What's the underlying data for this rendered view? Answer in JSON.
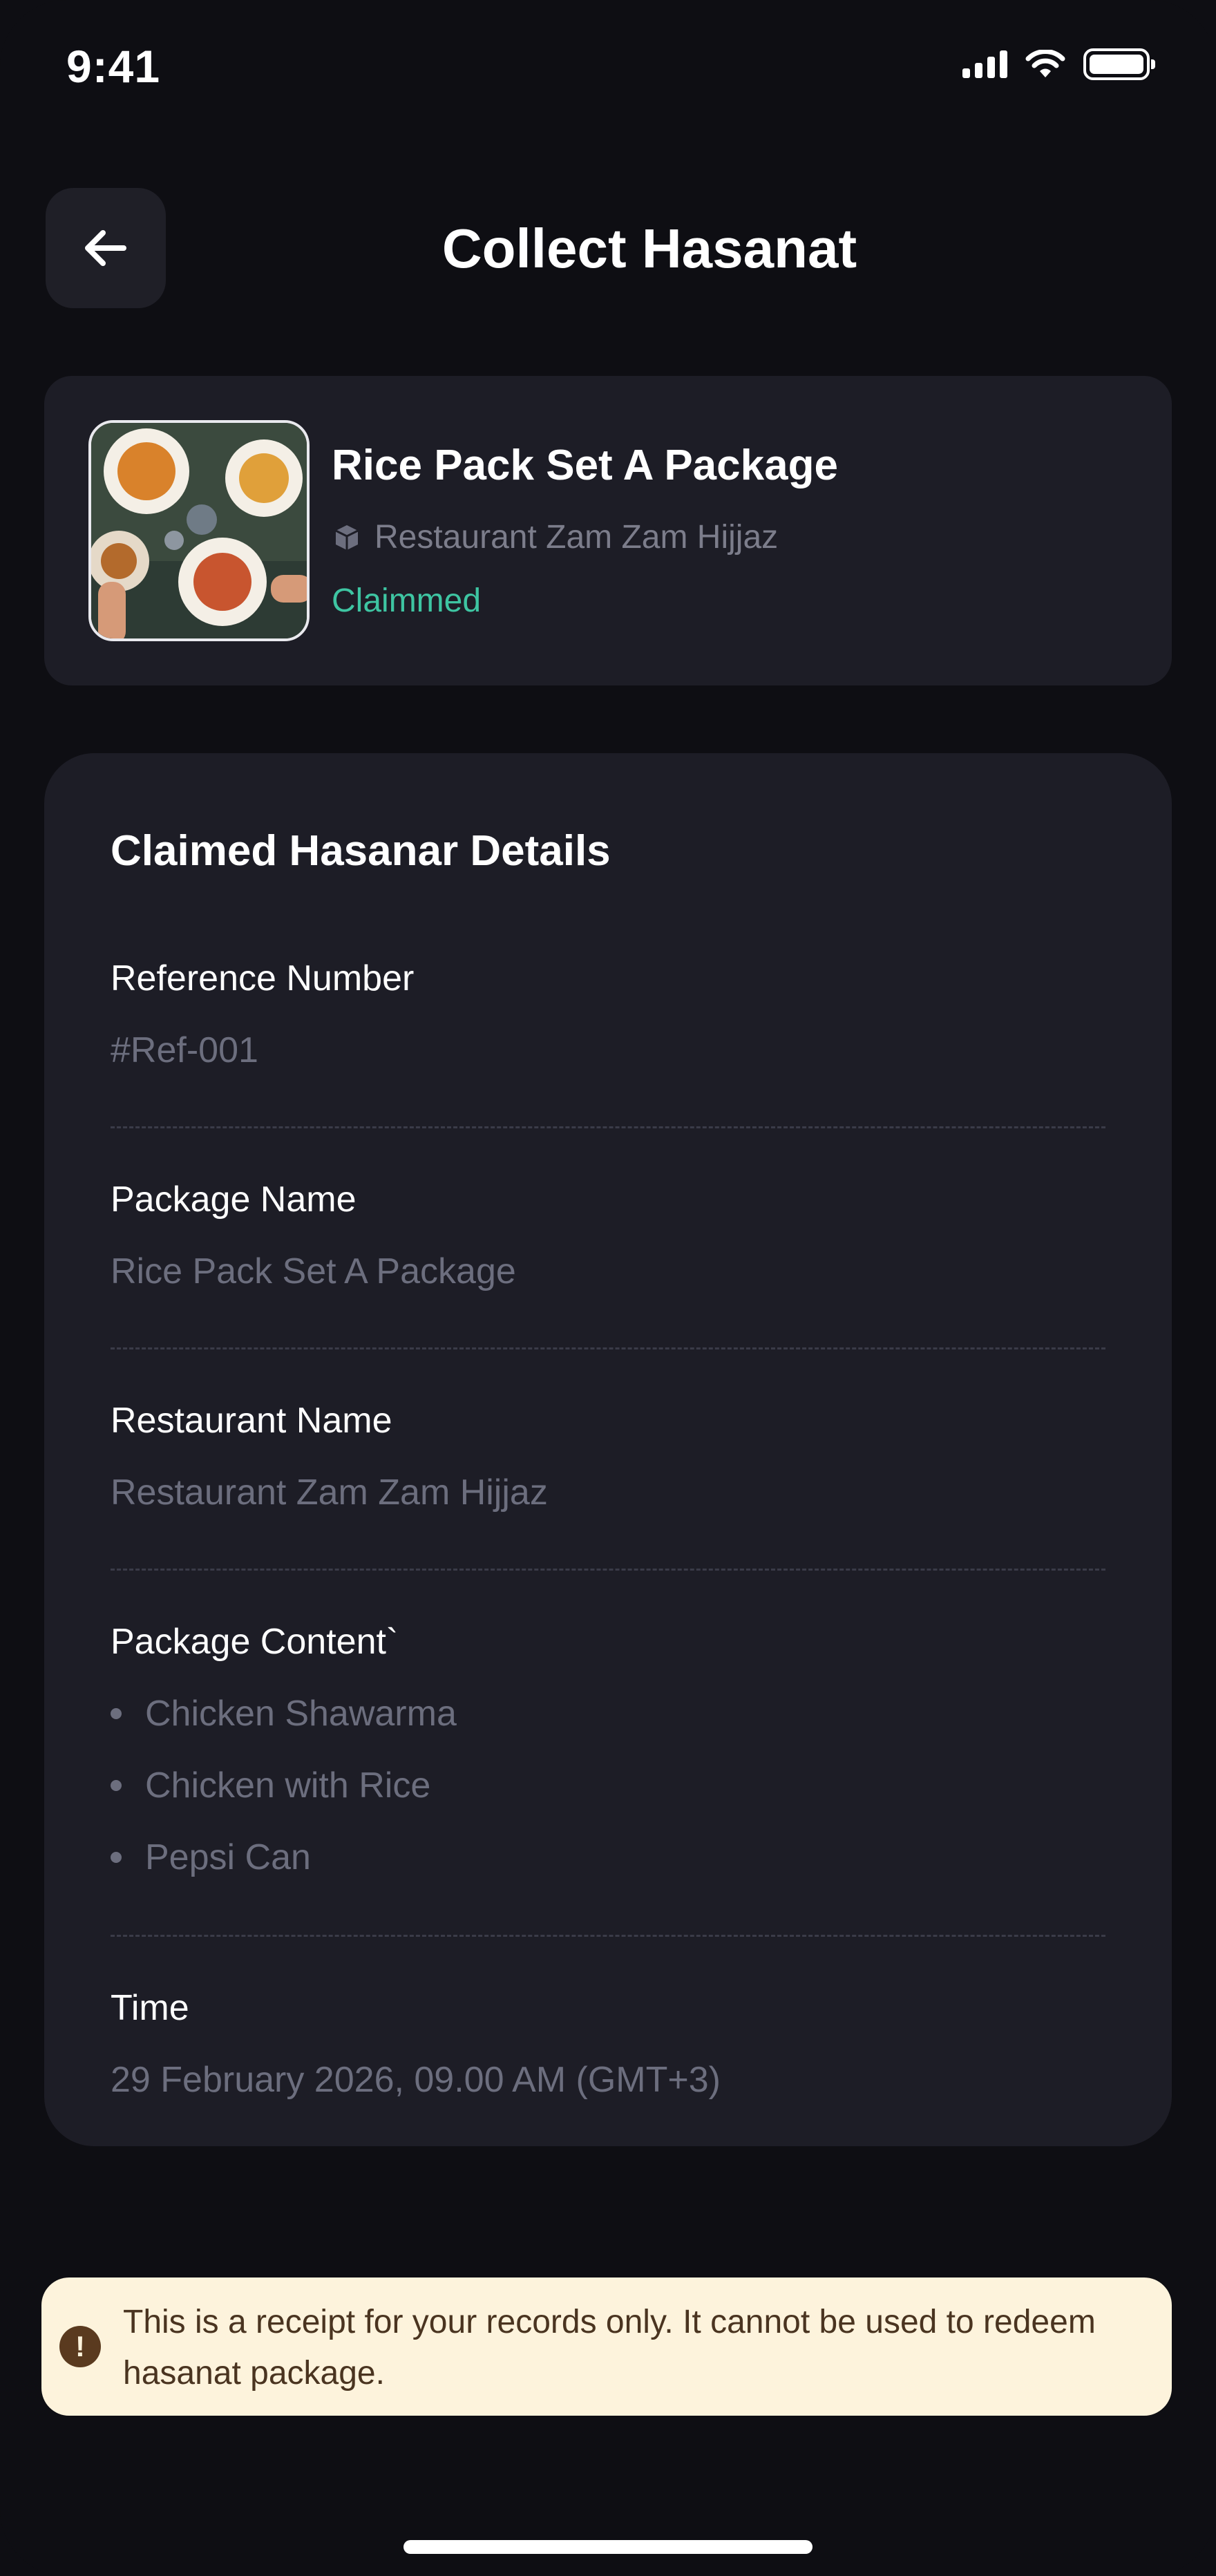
{
  "status_bar": {
    "time": "9:41"
  },
  "header": {
    "title": "Collect Hasanat"
  },
  "package": {
    "name": "Rice Pack Set A Package",
    "restaurant": "Restaurant Zam Zam Hijjaz",
    "status": "Claimmed"
  },
  "details": {
    "title": "Claimed Hasanar Details",
    "reference": {
      "label": "Reference Number",
      "value": "#Ref-001"
    },
    "package_name": {
      "label": "Package Name",
      "value": "Rice Pack Set A Package"
    },
    "restaurant_name": {
      "label": "Restaurant Name",
      "value": "Restaurant Zam Zam Hijjaz"
    },
    "content": {
      "label": "Package Content`",
      "items": [
        "Chicken Shawarma",
        "Chicken with Rice",
        "Pepsi Can"
      ]
    },
    "time": {
      "label": "Time",
      "value": "29 February 2026, 09.00 AM (GMT+3)"
    }
  },
  "notice": {
    "icon": "alert-icon",
    "text": "This is a receipt for your records only. It cannot be used to redeem hasanat package."
  },
  "colors": {
    "background": "#0e0e13",
    "card": "#1d1d26",
    "status_green": "#3ec5a2",
    "muted_text": "#6c6e7e",
    "notice_bg": "#fdf3dc"
  }
}
